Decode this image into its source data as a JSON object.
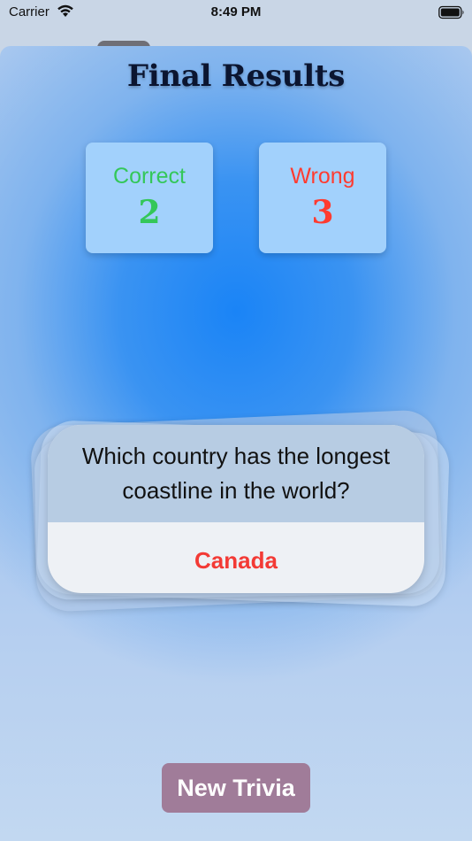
{
  "status_bar": {
    "carrier": "Carrier",
    "time": "8:49 PM"
  },
  "results": {
    "title": "Final Results",
    "correct_label": "Correct",
    "correct_value": "2",
    "wrong_label": "Wrong",
    "wrong_value": "3"
  },
  "card": {
    "question": "Which country has the longest coastline in the world?",
    "answer": "Canada"
  },
  "actions": {
    "new_trivia_label": "New Trivia"
  },
  "colors": {
    "correct": "#34c759",
    "wrong": "#ff3b30",
    "answer": "#f33a35",
    "button": "#a07c99",
    "sheet_center": "#1a84f6"
  },
  "icons": {
    "wifi": "wifi-icon",
    "battery": "battery-icon"
  }
}
